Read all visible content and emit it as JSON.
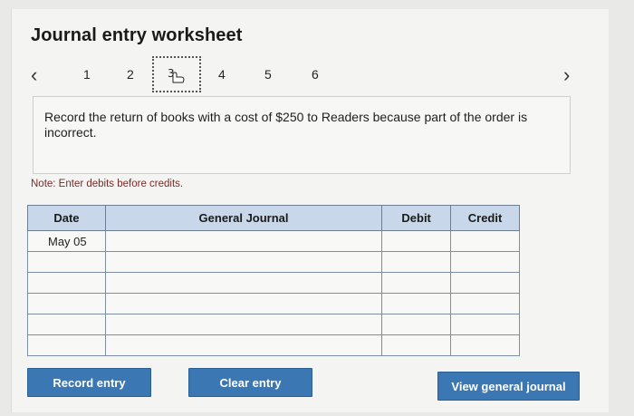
{
  "worksheet": {
    "title": "Journal entry worksheet"
  },
  "nav": {
    "prev_icon": "chevron-left-icon",
    "next_icon": "chevron-right-icon",
    "pages": [
      "1",
      "2",
      "3",
      "4",
      "5",
      "6"
    ],
    "active_page": "3"
  },
  "prompt": {
    "text": "Record the return of books with a cost of $250 to Readers because part of the order is incorrect."
  },
  "note": {
    "text": "Note: Enter debits before credits."
  },
  "table": {
    "headers": {
      "date": "Date",
      "general_journal": "General Journal",
      "debit": "Debit",
      "credit": "Credit"
    },
    "rows": [
      {
        "date": "May 05",
        "account": "",
        "debit": "",
        "credit": ""
      },
      {
        "date": "",
        "account": "",
        "debit": "",
        "credit": ""
      },
      {
        "date": "",
        "account": "",
        "debit": "",
        "credit": ""
      },
      {
        "date": "",
        "account": "",
        "debit": "",
        "credit": ""
      },
      {
        "date": "",
        "account": "",
        "debit": "",
        "credit": ""
      },
      {
        "date": "",
        "account": "",
        "debit": "",
        "credit": ""
      }
    ]
  },
  "buttons": {
    "record": "Record entry",
    "clear": "Clear entry",
    "view": "View general journal"
  },
  "colors": {
    "button_blue": "#3b77b3",
    "header_blue": "#c8d8ea",
    "note_red": "#7a2a2a"
  }
}
